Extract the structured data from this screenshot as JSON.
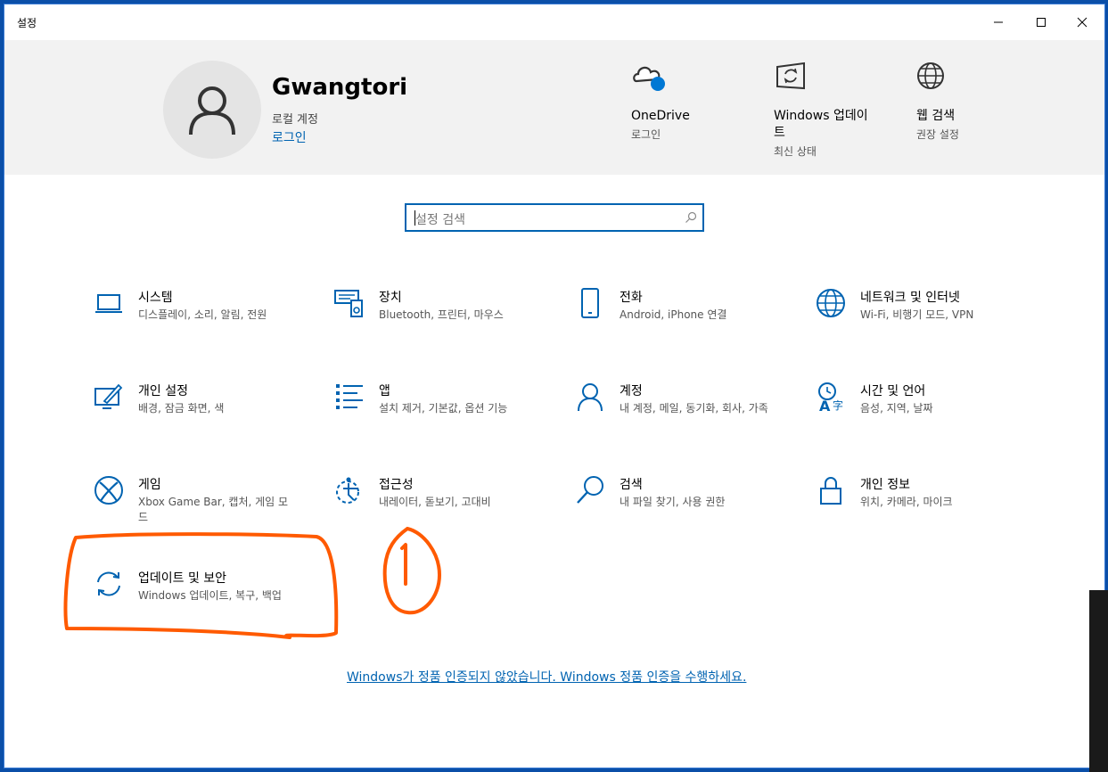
{
  "window": {
    "title": "설정"
  },
  "header": {
    "username": "Gwangtori",
    "account_type": "로컬 계정",
    "signin_link": "로그인",
    "quick_links": [
      {
        "title": "OneDrive",
        "subtitle": "로그인",
        "icon": "onedrive-cloud-icon"
      },
      {
        "title": "Windows 업데이트",
        "subtitle": "최신 상태",
        "icon": "windows-update-icon"
      },
      {
        "title": "웹 검색",
        "subtitle": "권장 설정",
        "icon": "globe-icon"
      }
    ]
  },
  "search": {
    "placeholder": "설정 검색"
  },
  "categories": [
    {
      "name": "시스템",
      "desc": "디스플레이, 소리, 알림, 전원",
      "icon": "laptop-icon"
    },
    {
      "name": "장치",
      "desc": "Bluetooth, 프린터, 마우스",
      "icon": "devices-icon"
    },
    {
      "name": "전화",
      "desc": "Android, iPhone 연결",
      "icon": "phone-icon"
    },
    {
      "name": "네트워크 및 인터넷",
      "desc": "Wi-Fi, 비행기 모드, VPN",
      "icon": "globe-icon"
    },
    {
      "name": "개인 설정",
      "desc": "배경, 잠금 화면, 색",
      "icon": "personalization-icon"
    },
    {
      "name": "앱",
      "desc": "설치 제거, 기본값, 옵션 기능",
      "icon": "apps-list-icon"
    },
    {
      "name": "계정",
      "desc": "내 계정, 메일, 동기화, 회사, 가족",
      "icon": "person-icon"
    },
    {
      "name": "시간 및 언어",
      "desc": "음성, 지역, 날짜",
      "icon": "time-language-icon"
    },
    {
      "name": "게임",
      "desc": "Xbox Game Bar, 캡처, 게임 모드",
      "icon": "xbox-icon"
    },
    {
      "name": "접근성",
      "desc": "내레이터, 돋보기, 고대비",
      "icon": "accessibility-icon"
    },
    {
      "name": "검색",
      "desc": "내 파일 찾기, 사용 권한",
      "icon": "magnifier-icon"
    },
    {
      "name": "개인 정보",
      "desc": "위치, 카메라, 마이크",
      "icon": "lock-icon"
    },
    {
      "name": "업데이트 및 보안",
      "desc": "Windows 업데이트, 복구, 백업",
      "icon": "sync-arrows-icon"
    }
  ],
  "activation_link": "Windows가 정품 인증되지 않았습니다. Windows 정품 인증을 수행하세요.",
  "colors": {
    "accent": "#0063b1",
    "annotation": "#ff5a00",
    "header_bg": "#f2f2f2"
  }
}
